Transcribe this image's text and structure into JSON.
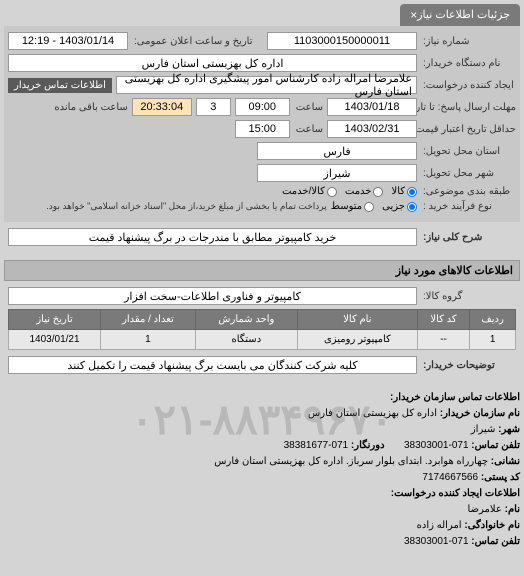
{
  "tab": {
    "title": "جزئیات اطلاعات نیاز",
    "close": "×"
  },
  "form": {
    "request_number_label": "شماره نیاز:",
    "request_number": "1103000150000011",
    "public_datetime_label": "تاریخ و ساعت اعلان عمومی:",
    "public_datetime": "1403/01/14 - 12:19",
    "buyer_org_label": "نام دستگاه خریدار:",
    "buyer_org": "اداره کل بهزیستی استان فارس",
    "creator_label": "ایجاد کننده درخواست:",
    "creator": "علامرضا امراله زاده کارشناس امور پیشگیری اداره کل بهزیستی استان فارس",
    "contact_btn": "اطلاعات تماس خریدار",
    "deadline_label": "مهلت ارسال پاسخ: تا تاریخ:",
    "deadline_date": "1403/01/18",
    "deadline_hour_label": "ساعت",
    "deadline_hour": "09:00",
    "remaining_count": "3",
    "remaining_time": "20:33:04",
    "remaining_label": "ساعت باقی مانده",
    "price_until_label": "حداقل تاریخ اعتبار قیمت: تا تاریخ:",
    "price_until_date": "1403/02/31",
    "price_until_hour_label": "ساعت",
    "price_until_hour": "15:00",
    "province_label": "استان محل تحویل:",
    "province": "فارس",
    "city_label": "شهر محل تحویل:",
    "city": "شیراز",
    "category_label": "طبقه بندی موضوعی:",
    "category_options": {
      "kala": "کالا",
      "service": "خدمت",
      "both": "کالا/خدمت"
    },
    "purchase_type_label": "نوع فرآیند خرید :",
    "purchase_options": {
      "small": "جزیی",
      "medium": "متوسط"
    },
    "purchase_note": "پرداخت تمام یا بخشی از مبلغ خرید،از محل \"اسناد خزانه اسلامی\" خواهد بود.",
    "general_desc_label": "شرح کلی نیاز:",
    "general_desc": "خرید کامپیوتر مطابق با مندرجات در برگ پیشنهاد قیمت",
    "goods_info_title": "اطلاعات کالاهای مورد نیاز",
    "goods_group_label": "گروه کالا:",
    "goods_group": "کامپیوتر و فناوری اطلاعات-سخت افزار"
  },
  "table": {
    "headers": {
      "row": "ردیف",
      "code": "کد کالا",
      "name": "نام کالا",
      "unit": "واحد شمارش",
      "qty": "تعداد / مقدار",
      "date": "تاریخ نیاز"
    },
    "rows": [
      {
        "row": "1",
        "code": "--",
        "name": "کامپیوتر رومیزی",
        "unit": "دستگاه",
        "qty": "1",
        "date": "1403/01/21"
      }
    ]
  },
  "buyer_notes_label": "توضیحات خریدار:",
  "buyer_notes": "کلیه شرکت کنندگان می بایست برگ پیشنهاد قیمت را تکمیل کنند",
  "contact": {
    "title": "اطلاعات تماس سازمان خریدار:",
    "org_label": "نام سازمان خریدار:",
    "org": "اداره کل بهزیستی استان فارس",
    "city_label": "شهر:",
    "city": "شیراز",
    "phone_label": "تلفن تماس:",
    "phone": "071-38303001",
    "fax_label": "دورنگار:",
    "fax": "071-38381677",
    "address_label": "نشانی:",
    "address": "چهارراه هوابرد. ابتدای بلوار سرباز. اداره کل بهزیستی استان فارس",
    "postal_label": "کد پستی:",
    "postal": "7174667566",
    "creator_title": "اطلاعات ایجاد کننده درخواست:",
    "fname_label": "نام:",
    "fname": "علامرضا",
    "lname_label": "نام خانوادگی:",
    "lname": "امراله زاده",
    "cphone_label": "تلفن تماس:",
    "cphone": "071-38303001"
  },
  "watermark": "۰۲۱-۸۸۳۴۹۶۷۰"
}
